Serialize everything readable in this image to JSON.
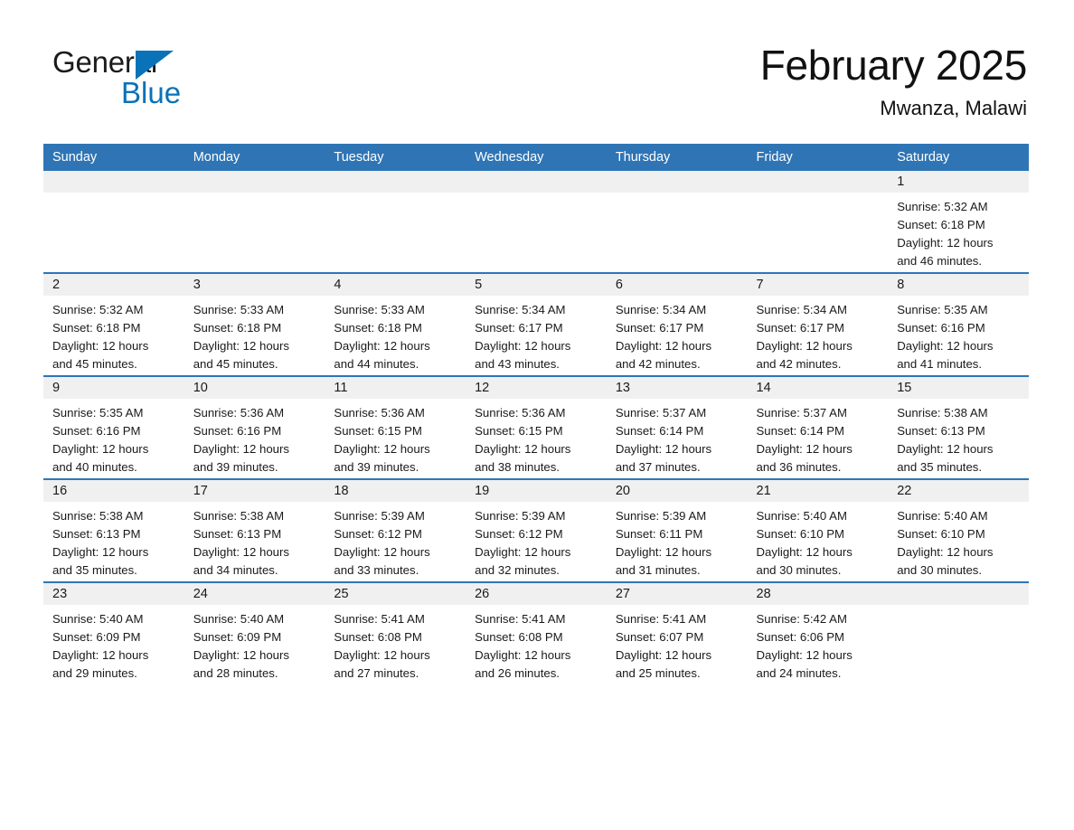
{
  "brand": {
    "word1": "General",
    "word2": "Blue",
    "triangle_color": "#0a72b8"
  },
  "header": {
    "month_title": "February 2025",
    "location": "Mwanza, Malawi"
  },
  "theme": {
    "header_blue": "#2f75b5",
    "daynum_band": "#f0f0f0",
    "text": "#1a1a1a"
  },
  "weekday_headers": [
    "Sunday",
    "Monday",
    "Tuesday",
    "Wednesday",
    "Thursday",
    "Friday",
    "Saturday"
  ],
  "weeks": [
    [
      {
        "day": "",
        "lines": []
      },
      {
        "day": "",
        "lines": []
      },
      {
        "day": "",
        "lines": []
      },
      {
        "day": "",
        "lines": []
      },
      {
        "day": "",
        "lines": []
      },
      {
        "day": "",
        "lines": []
      },
      {
        "day": "1",
        "lines": [
          "Sunrise: 5:32 AM",
          "Sunset: 6:18 PM",
          "Daylight: 12 hours",
          "and 46 minutes."
        ]
      }
    ],
    [
      {
        "day": "2",
        "lines": [
          "Sunrise: 5:32 AM",
          "Sunset: 6:18 PM",
          "Daylight: 12 hours",
          "and 45 minutes."
        ]
      },
      {
        "day": "3",
        "lines": [
          "Sunrise: 5:33 AM",
          "Sunset: 6:18 PM",
          "Daylight: 12 hours",
          "and 45 minutes."
        ]
      },
      {
        "day": "4",
        "lines": [
          "Sunrise: 5:33 AM",
          "Sunset: 6:18 PM",
          "Daylight: 12 hours",
          "and 44 minutes."
        ]
      },
      {
        "day": "5",
        "lines": [
          "Sunrise: 5:34 AM",
          "Sunset: 6:17 PM",
          "Daylight: 12 hours",
          "and 43 minutes."
        ]
      },
      {
        "day": "6",
        "lines": [
          "Sunrise: 5:34 AM",
          "Sunset: 6:17 PM",
          "Daylight: 12 hours",
          "and 42 minutes."
        ]
      },
      {
        "day": "7",
        "lines": [
          "Sunrise: 5:34 AM",
          "Sunset: 6:17 PM",
          "Daylight: 12 hours",
          "and 42 minutes."
        ]
      },
      {
        "day": "8",
        "lines": [
          "Sunrise: 5:35 AM",
          "Sunset: 6:16 PM",
          "Daylight: 12 hours",
          "and 41 minutes."
        ]
      }
    ],
    [
      {
        "day": "9",
        "lines": [
          "Sunrise: 5:35 AM",
          "Sunset: 6:16 PM",
          "Daylight: 12 hours",
          "and 40 minutes."
        ]
      },
      {
        "day": "10",
        "lines": [
          "Sunrise: 5:36 AM",
          "Sunset: 6:16 PM",
          "Daylight: 12 hours",
          "and 39 minutes."
        ]
      },
      {
        "day": "11",
        "lines": [
          "Sunrise: 5:36 AM",
          "Sunset: 6:15 PM",
          "Daylight: 12 hours",
          "and 39 minutes."
        ]
      },
      {
        "day": "12",
        "lines": [
          "Sunrise: 5:36 AM",
          "Sunset: 6:15 PM",
          "Daylight: 12 hours",
          "and 38 minutes."
        ]
      },
      {
        "day": "13",
        "lines": [
          "Sunrise: 5:37 AM",
          "Sunset: 6:14 PM",
          "Daylight: 12 hours",
          "and 37 minutes."
        ]
      },
      {
        "day": "14",
        "lines": [
          "Sunrise: 5:37 AM",
          "Sunset: 6:14 PM",
          "Daylight: 12 hours",
          "and 36 minutes."
        ]
      },
      {
        "day": "15",
        "lines": [
          "Sunrise: 5:38 AM",
          "Sunset: 6:13 PM",
          "Daylight: 12 hours",
          "and 35 minutes."
        ]
      }
    ],
    [
      {
        "day": "16",
        "lines": [
          "Sunrise: 5:38 AM",
          "Sunset: 6:13 PM",
          "Daylight: 12 hours",
          "and 35 minutes."
        ]
      },
      {
        "day": "17",
        "lines": [
          "Sunrise: 5:38 AM",
          "Sunset: 6:13 PM",
          "Daylight: 12 hours",
          "and 34 minutes."
        ]
      },
      {
        "day": "18",
        "lines": [
          "Sunrise: 5:39 AM",
          "Sunset: 6:12 PM",
          "Daylight: 12 hours",
          "and 33 minutes."
        ]
      },
      {
        "day": "19",
        "lines": [
          "Sunrise: 5:39 AM",
          "Sunset: 6:12 PM",
          "Daylight: 12 hours",
          "and 32 minutes."
        ]
      },
      {
        "day": "20",
        "lines": [
          "Sunrise: 5:39 AM",
          "Sunset: 6:11 PM",
          "Daylight: 12 hours",
          "and 31 minutes."
        ]
      },
      {
        "day": "21",
        "lines": [
          "Sunrise: 5:40 AM",
          "Sunset: 6:10 PM",
          "Daylight: 12 hours",
          "and 30 minutes."
        ]
      },
      {
        "day": "22",
        "lines": [
          "Sunrise: 5:40 AM",
          "Sunset: 6:10 PM",
          "Daylight: 12 hours",
          "and 30 minutes."
        ]
      }
    ],
    [
      {
        "day": "23",
        "lines": [
          "Sunrise: 5:40 AM",
          "Sunset: 6:09 PM",
          "Daylight: 12 hours",
          "and 29 minutes."
        ]
      },
      {
        "day": "24",
        "lines": [
          "Sunrise: 5:40 AM",
          "Sunset: 6:09 PM",
          "Daylight: 12 hours",
          "and 28 minutes."
        ]
      },
      {
        "day": "25",
        "lines": [
          "Sunrise: 5:41 AM",
          "Sunset: 6:08 PM",
          "Daylight: 12 hours",
          "and 27 minutes."
        ]
      },
      {
        "day": "26",
        "lines": [
          "Sunrise: 5:41 AM",
          "Sunset: 6:08 PM",
          "Daylight: 12 hours",
          "and 26 minutes."
        ]
      },
      {
        "day": "27",
        "lines": [
          "Sunrise: 5:41 AM",
          "Sunset: 6:07 PM",
          "Daylight: 12 hours",
          "and 25 minutes."
        ]
      },
      {
        "day": "28",
        "lines": [
          "Sunrise: 5:42 AM",
          "Sunset: 6:06 PM",
          "Daylight: 12 hours",
          "and 24 minutes."
        ]
      },
      {
        "day": "",
        "lines": []
      }
    ]
  ]
}
